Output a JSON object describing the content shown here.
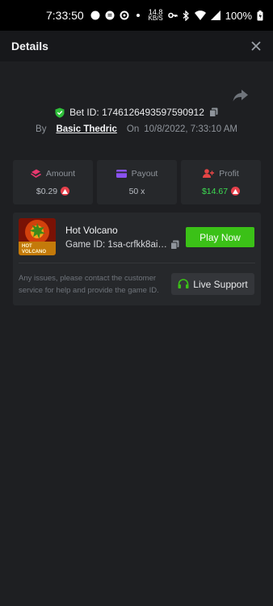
{
  "status_bar": {
    "time": "7:33:50",
    "net_speed": "14.8",
    "net_unit": "KB/S",
    "battery": "100%"
  },
  "header": {
    "title": "Details",
    "close_icon": "close-icon"
  },
  "bet": {
    "bet_id_label": "Bet ID: 1746126493597590912",
    "by_label": "By",
    "user": "Basic Thedric",
    "on_label": "On",
    "datetime": "10/8/2022, 7:33:10 AM"
  },
  "stats": {
    "amount": {
      "label": "Amount",
      "value": "$0.29",
      "icon": "amount-icon",
      "color": "#e8386e"
    },
    "payout": {
      "label": "Payout",
      "value": "50 x",
      "icon": "card-icon",
      "color": "#8a52f0"
    },
    "profit": {
      "label": "Profit",
      "value": "$14.67",
      "icon": "profit-icon",
      "color": "#e54545",
      "value_color": "#3ddc52"
    }
  },
  "game": {
    "name": "Hot Volcano",
    "game_id": "Game ID: 1sa-crfkk8ai-...",
    "thumb_line1": "HOT",
    "thumb_line2": "VOLCANO",
    "play_label": "Play Now",
    "note": "Any issues, please contact the customer service for help and provide the game ID.",
    "support_label": "Live Support"
  },
  "colors": {
    "background": "#1e1f22",
    "card": "#26282b",
    "accent_green": "#3bc117",
    "coin_red": "#e6404b"
  }
}
